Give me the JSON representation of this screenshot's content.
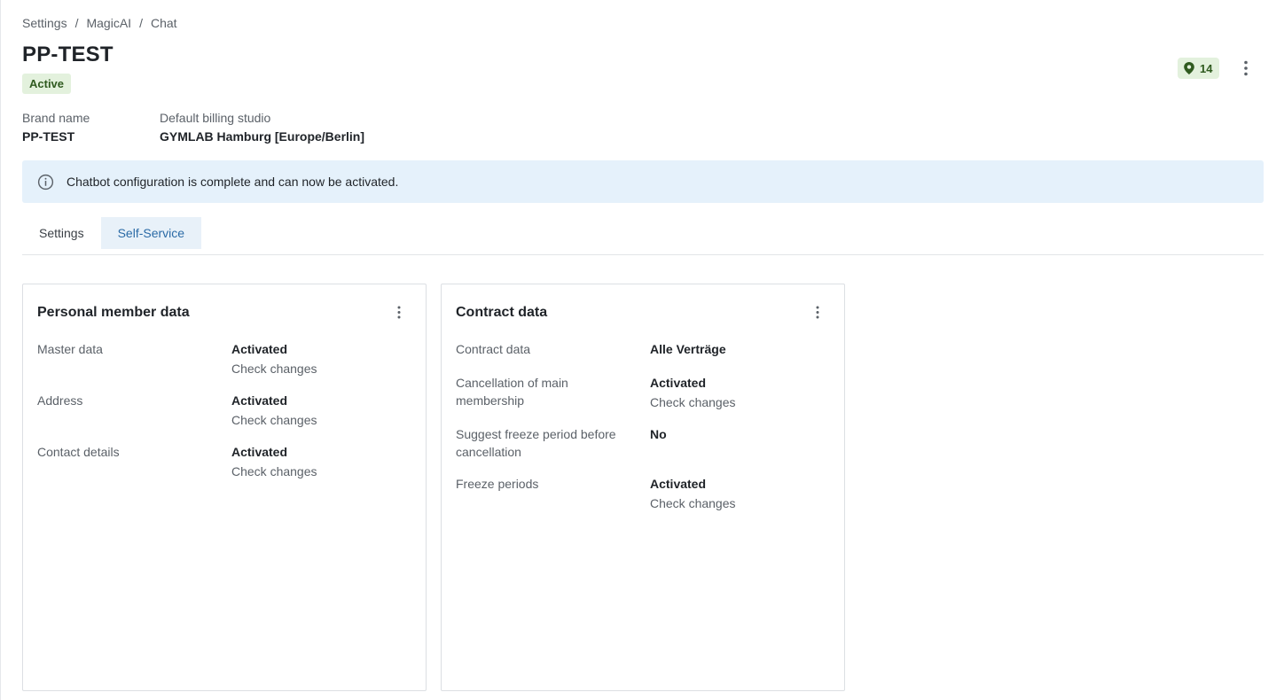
{
  "breadcrumb": [
    "Settings",
    "MagicAI",
    "Chat"
  ],
  "breadcrumb_separator": "/",
  "page": {
    "title": "PP-TEST",
    "status": "Active",
    "location_count": "14"
  },
  "meta": {
    "brand_label": "Brand name",
    "brand_value": "PP-TEST",
    "studio_label": "Default billing studio",
    "studio_value": "GYMLAB Hamburg [Europe/Berlin]"
  },
  "banner": {
    "text": "Chatbot configuration is complete and can now be activated."
  },
  "tabs": [
    {
      "label": "Settings",
      "active": false
    },
    {
      "label": "Self-Service",
      "active": true
    }
  ],
  "cards": {
    "member": {
      "title": "Personal member data",
      "rows": [
        {
          "label": "Master data",
          "value": "Activated",
          "link": "Check changes"
        },
        {
          "label": "Address",
          "value": "Activated",
          "link": "Check changes"
        },
        {
          "label": "Contact details",
          "value": "Activated",
          "link": "Check changes"
        }
      ]
    },
    "contract": {
      "title": "Contract data",
      "rows": [
        {
          "label": "Contract data",
          "value": "Alle Verträge"
        },
        {
          "label": "Cancellation of main membership",
          "value": "Activated",
          "link": "Check changes"
        },
        {
          "label": "Suggest freeze period before cancellation",
          "value": "No"
        },
        {
          "label": "Freeze periods",
          "value": "Activated",
          "link": "Check changes"
        }
      ]
    }
  },
  "colors": {
    "status_bg": "#e3f1dd",
    "status_text": "#2f5a1f",
    "banner_bg": "#e5f1fb",
    "tab_active_bg": "#e8f1f9",
    "tab_active_text": "#2a6aa6"
  },
  "icons": {
    "location": "map-pin-icon",
    "more": "more-vertical-icon",
    "info": "info-circle-icon"
  }
}
